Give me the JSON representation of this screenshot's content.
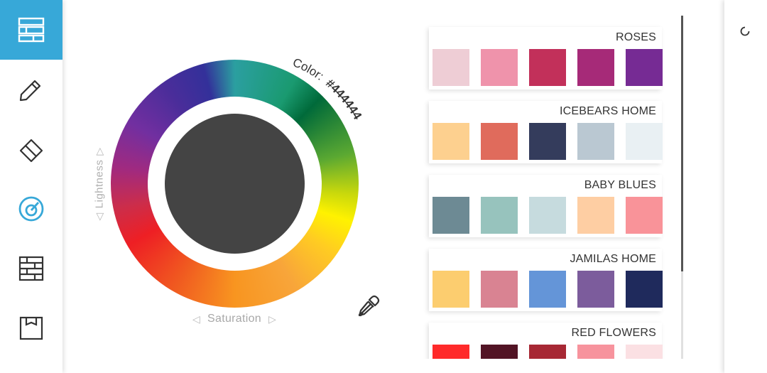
{
  "sidebar": {
    "items": [
      {
        "name": "layout-icon",
        "active": true
      },
      {
        "name": "pencil-icon",
        "active": false
      },
      {
        "name": "eraser-icon",
        "active": false
      },
      {
        "name": "color-picker-icon",
        "active": false
      },
      {
        "name": "texture-icon",
        "active": false
      },
      {
        "name": "frame-icon",
        "active": false
      }
    ],
    "active_color": "#37a8d8",
    "accent_color": "#37a8d8"
  },
  "picker": {
    "color_label": "Color:",
    "color_value": "#444444",
    "lightness_label": "Lightness",
    "saturation_label": "Saturation",
    "left_arrow": "◁",
    "right_arrow": "▷"
  },
  "palettes": [
    {
      "name": "ROSES",
      "colors": [
        "#eecdd5",
        "#ef93ab",
        "#c2305a",
        "#a62a78",
        "#762b94"
      ]
    },
    {
      "name": "ICEBEARS HOME",
      "colors": [
        "#fdd08f",
        "#e06b5c",
        "#343c5c",
        "#bac8d2",
        "#e9f0f3"
      ]
    },
    {
      "name": "BABY BLUES",
      "colors": [
        "#6d8a94",
        "#97c3bd",
        "#c6dbde",
        "#fecea3",
        "#f99399"
      ]
    },
    {
      "name": "JAMILAS HOME",
      "colors": [
        "#fccd6f",
        "#d98392",
        "#6495d8",
        "#7c5c9c",
        "#1f2a5c"
      ]
    },
    {
      "name": "RED FLOWERS",
      "colors": [
        "#ff2a2a",
        "#521425",
        "#a72834",
        "#f7939d",
        "#fbe0e3"
      ]
    }
  ]
}
